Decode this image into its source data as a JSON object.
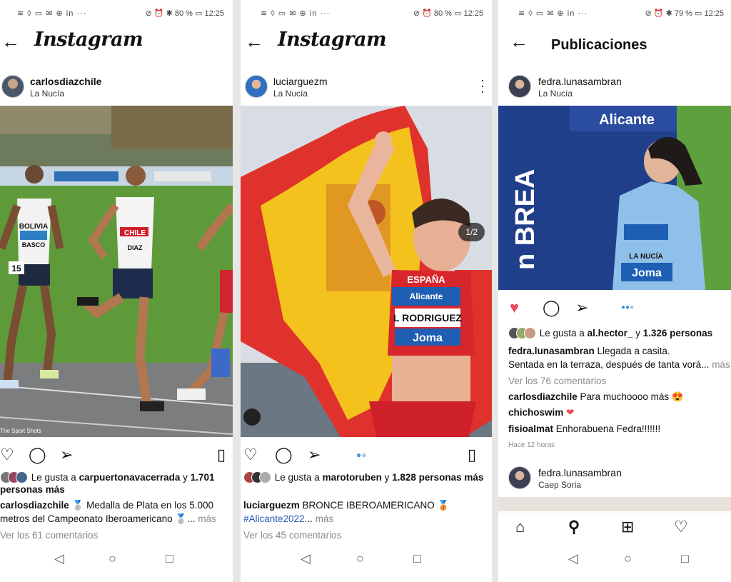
{
  "status": {
    "icons": "≋ ◊ ▭ ✉ ⊕ in ···",
    "p1_right": "⊘ ⏰ ✱ 80 % ▭ 12:25",
    "p2_right": "⊘ ⏰ 80 % ▭ 12:25",
    "p3_right": "⊘ ⏰ ✱ 79 % ▭ 12:25"
  },
  "app_logo": "Instagram",
  "p3_title": "Publicaciones",
  "post1": {
    "username": "carlosdiazchile",
    "location": "La Nucía",
    "bibs": {
      "bolivia": "BOLIVIA",
      "basco": "BASCO",
      "num": "15",
      "chile": "CHILE",
      "diaz": "DIAZ"
    },
    "watermark": "The Sport Shots",
    "likes_prefix": "Le gusta a ",
    "likes_user": "carpuertonavacerrada",
    "likes_mid": " y ",
    "likes_count": "1.701 personas más",
    "caption_user": "carlosdiazchile",
    "caption_text": " 🥈 Medalla de Plata en los 5.000 metros del Campeonato Iberoamericano 🥈...",
    "more": " más",
    "comments": "Ver los 61 comentarios"
  },
  "post2": {
    "username": "luciarguezm",
    "location": "La Nucía",
    "pager": "1/2",
    "bib_name": "L RODRIGUEZ",
    "bib_brand": "Joma",
    "bib_city": "Alicante",
    "top_text": "ESPAÑA",
    "likes_prefix": "Le gusta a ",
    "likes_user": "marotoruben",
    "likes_mid": " y ",
    "likes_count": "1.828 personas más",
    "caption_user": "luciarguezm",
    "caption_text": " BRONCE IBEROAMERICANO 🥉 ",
    "hashtag": "#Alicante2022",
    "ellipsis": "... ",
    "more": "más",
    "comments": "Ver los 45 comentarios"
  },
  "post3": {
    "username": "fedra.lunasambran",
    "location": "La Nucía",
    "banner_brand": "Alicante",
    "banner_text": "n BREA",
    "shirt_city": "LA NUCÍA",
    "shirt_brand": "Joma",
    "likes_prefix": "Le gusta a ",
    "likes_user": "al.hector_",
    "likes_mid": " y ",
    "likes_count": "1.326 personas",
    "caption_user": "fedra.lunasambran",
    "caption_line1": " Llegada a casita.",
    "caption_line2": "Sentada en la terraza, después de tanta vorá... ",
    "more": "más",
    "comments": "Ver los 76 comentarios",
    "c1_user": "carlosdiazchile",
    "c1_text": " Para muchoooo más 😍",
    "c2_user": "chichoswim",
    "c2_text": " ❤",
    "c3_user": "fisioalmat",
    "c3_text": " Enhorabuena Fedra!!!!!!!",
    "time": "Hace 12 horas",
    "next_username": "fedra.lunasambran",
    "next_location": "Caep Soria"
  },
  "colors": {
    "like_red": "#ed4956",
    "link_blue": "#2a5bb8",
    "carousel_blue": "#3897f0"
  }
}
